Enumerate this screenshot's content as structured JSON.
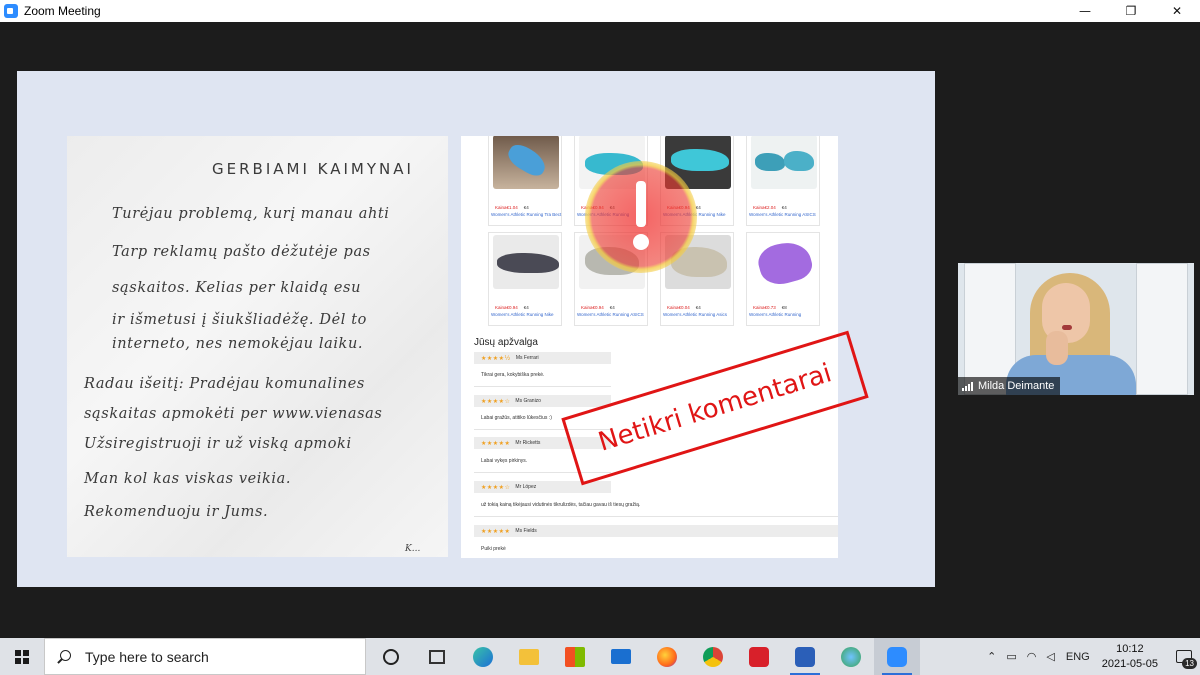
{
  "window": {
    "title": "Zoom Meeting",
    "minimize_glyph": "—",
    "restore_glyph": "❐",
    "close_glyph": "✕"
  },
  "letter": {
    "heading": "GERBIAMI KAIMYNAI",
    "lines": [
      "Turėjau problemą, kurį manau ahti",
      "Tarp reklamų pašto dėžutėje pas",
      "sąskaitos. Kelias per klaidą esu",
      "ir išmetusi į šiukšliadėžę. Dėl to",
      "interneto, nes nemokėjau laiku.",
      "Radau išeitį: Pradėjau komunalines",
      "sąskaitas apmokėti per www.vienasas",
      "Užsiregistruoji ir už viską apmoki",
      "Man kol kas viskas veikia.",
      "Rekomenduoju ir Jums."
    ],
    "corner_mark": "K..."
  },
  "shop": {
    "products": [
      {
        "price": "Kaina€1.04",
        "currency": "€4",
        "name": "Women's Athletic Running Tra Bect"
      },
      {
        "price": "Kaina€0.94",
        "currency": "€4",
        "name": "Women's Athletic Running"
      },
      {
        "price": "Kaina€0.94",
        "currency": "€4",
        "name": "Women's Athletic Running Nike"
      },
      {
        "price": "Kaina€2.04",
        "currency": "€4",
        "name": "Women's Athletic Running ASICS"
      },
      {
        "price": "Kaina€0.94",
        "currency": "€4",
        "name": "Women's Athletic Running Nike"
      },
      {
        "price": "Kaina€0.94",
        "currency": "€4",
        "name": "Women's Athletic Running ASICS"
      },
      {
        "price": "Kaina€0.04",
        "currency": "€4",
        "name": "Women's Athletic Running Asics"
      },
      {
        "price": "Kaina€0.73",
        "currency": "€8",
        "name": "Women's Athletic Running"
      }
    ],
    "reviews_title": "Jūsų apžvalga",
    "reviews": [
      {
        "stars": "★★★★½",
        "name": "Ms Ferrari",
        "text": "Tikrai gera, kokybiška prekė."
      },
      {
        "stars": "★★★★☆",
        "name": "Ms Granizo",
        "text": "Labai gražūs, atitiko lūkesčius :)"
      },
      {
        "stars": "★★★★★",
        "name": "Mr Ricketts",
        "text": "Labai vykęs pirkinys."
      },
      {
        "stars": "★★★★☆",
        "name": "Mr López",
        "text": "už tokią kainą tikėjausi vidutinės tikrulizdės, tačiau gavau iš tiesų gražią."
      },
      {
        "stars": "★★★★★",
        "name": "Ms Fields",
        "text": "Puiki prekė"
      }
    ]
  },
  "stamp": {
    "text": "Netikri komentarai"
  },
  "participant": {
    "name": "Milda Deimante"
  },
  "taskbar": {
    "search_placeholder": "Type here to search",
    "apps": [
      {
        "name": "cortana-icon",
        "color": "#222222"
      },
      {
        "name": "task-view-icon",
        "color": "#333333"
      },
      {
        "name": "edge-icon",
        "color": "#1c8ad6"
      },
      {
        "name": "file-explorer-icon",
        "color": "#f3c13a"
      },
      {
        "name": "store-icon",
        "color": "#3a7bd5"
      },
      {
        "name": "mail-icon",
        "color": "#1a6fd0"
      },
      {
        "name": "firefox-icon",
        "color": "#ff6b1a"
      },
      {
        "name": "chrome-icon",
        "color": "#2ea44f"
      },
      {
        "name": "acrobat-icon",
        "color": "#d8202a"
      },
      {
        "name": "word-icon",
        "color": "#2b5fb8"
      },
      {
        "name": "maps-icon",
        "color": "#3aa357"
      },
      {
        "name": "zoom-icon",
        "color": "#2d8cff"
      }
    ],
    "language": "ENG",
    "time": "10:12",
    "date": "2021-05-05",
    "notification_count": "13"
  }
}
